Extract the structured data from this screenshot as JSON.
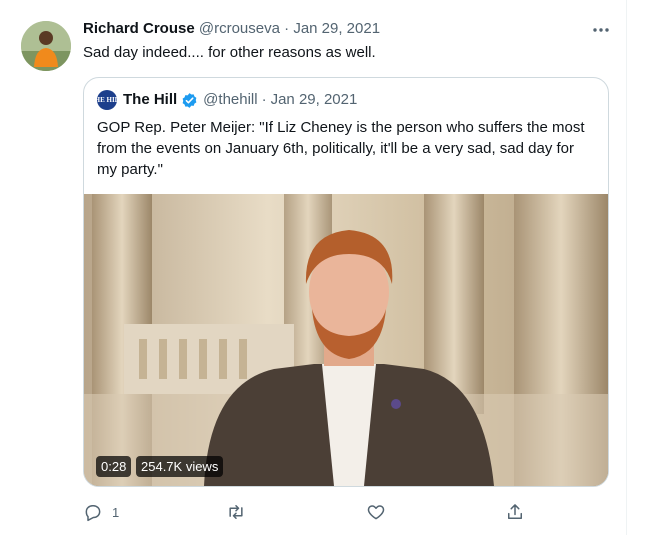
{
  "tweet": {
    "author_name": "Richard Crouse",
    "author_handle": "@rcrouseva",
    "separator": "·",
    "date": "Jan 29, 2021",
    "text": "Sad day indeed.... for other reasons as well.",
    "more_icon": "more-horizontal-icon"
  },
  "quoted": {
    "logo_text": "THE HILL",
    "name": "The Hill",
    "handle": "@thehill",
    "separator": "·",
    "date": "Jan 29, 2021",
    "text": "GOP Rep. Peter Meijer: \"If Liz Cheney is the person who suffers the most from the events on January 6th, politically, it'll be a very sad, sad day for my party.\"",
    "verified_color": "#1d9bf0",
    "video": {
      "duration": "0:28",
      "views": "254.7K views"
    }
  },
  "actions": {
    "reply_count": "1",
    "retweet_count": "",
    "like_count": "",
    "icons": [
      "reply-icon",
      "retweet-icon",
      "like-icon",
      "share-icon"
    ]
  }
}
